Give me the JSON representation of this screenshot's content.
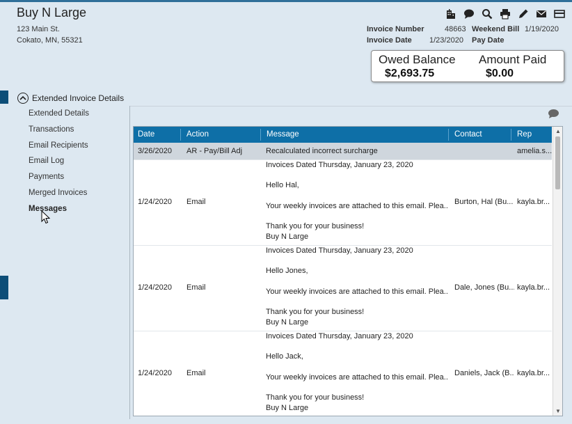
{
  "header": {
    "company": "Buy N Large",
    "address_line1": "123 Main St.",
    "address_line2": "Cokato,  MN,  55321"
  },
  "toolbar": [
    {
      "name": "building-icon"
    },
    {
      "name": "chat-icon"
    },
    {
      "name": "search-icon"
    },
    {
      "name": "print-icon"
    },
    {
      "name": "pencil-icon"
    },
    {
      "name": "mail-icon"
    },
    {
      "name": "card-icon"
    }
  ],
  "invoice": {
    "number_label": "Invoice Number",
    "number_value": "48663",
    "weekend_label": "Weekend Bill",
    "weekend_value": "1/19/2020",
    "date_label": "Invoice Date",
    "date_value": "1/23/2020",
    "pay_label": "Pay Date",
    "pay_value": ""
  },
  "balance": {
    "owed_label": "Owed Balance",
    "owed_value": "$2,693.75",
    "paid_label": "Amount Paid",
    "paid_value": "$0.00"
  },
  "nav": {
    "header": "Extended Invoice Details",
    "items": [
      "Extended Details",
      "Transactions",
      "Email Recipients",
      "Email Log",
      "Payments",
      "Merged Invoices",
      "Messages"
    ],
    "active_index": 6
  },
  "grid": {
    "columns": [
      "Date",
      "Action",
      "Message",
      "Contact",
      "Rep"
    ],
    "rows": [
      {
        "date": "3/26/2020",
        "action": "AR - Pay/Bill Adj",
        "message": [
          "Recalculated incorrect surcharge"
        ],
        "contact": "",
        "rep": "amelia.s..."
      },
      {
        "date": "1/24/2020",
        "action": "Email",
        "message": [
          "Invoices Dated Thursday, January 23, 2020",
          "",
          "Hello Hal,",
          "",
          " Your weekly invoices are attached to this email. Plea...",
          "",
          " Thank you for your business!",
          "Buy N Large"
        ],
        "contact": "Burton, Hal (Bu...",
        "rep": "kayla.br..."
      },
      {
        "date": "1/24/2020",
        "action": "Email",
        "message": [
          "Invoices Dated Thursday, January 23, 2020",
          "",
          "Hello Jones,",
          "",
          " Your weekly invoices are attached to this email. Plea...",
          "",
          " Thank you for your business!",
          "Buy N Large"
        ],
        "contact": "Dale, Jones (Bu...",
        "rep": "kayla.br..."
      },
      {
        "date": "1/24/2020",
        "action": "Email",
        "message": [
          "Invoices Dated Thursday, January 23, 2020",
          "",
          "Hello Jack,",
          "",
          " Your weekly invoices are attached to this email. Plea...",
          "",
          " Thank you for your business!",
          "Buy N Large"
        ],
        "contact": "Daniels, Jack (B...",
        "rep": "kayla.br..."
      }
    ]
  }
}
